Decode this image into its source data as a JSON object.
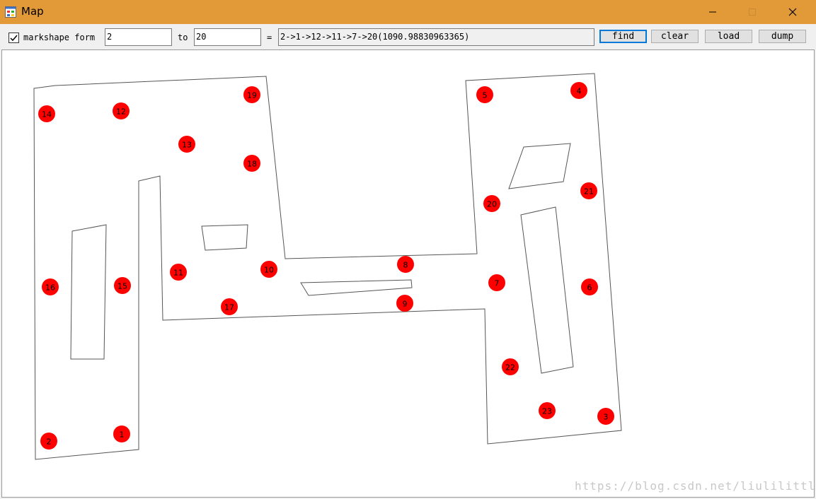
{
  "window": {
    "title": "Map",
    "icons": {
      "app": "app-window-icon",
      "minimize": "minimize-icon",
      "maximize": "maximize-icon",
      "close": "close-icon"
    }
  },
  "toolbar": {
    "markshape_checked": true,
    "markshape_label": "markshape form",
    "from_value": "2",
    "to_label": "to",
    "to_value": "20",
    "equals_label": "=",
    "result_value": "2->1->12->11->7->20(1090.98830963365)",
    "find_label": "find",
    "clear_label": "clear",
    "load_label": "load",
    "dump_label": "dump"
  },
  "map": {
    "nodes": [
      {
        "id": "1",
        "label": "1"
      },
      {
        "id": "2",
        "label": "2"
      },
      {
        "id": "3",
        "label": "3"
      },
      {
        "id": "4",
        "label": "4"
      },
      {
        "id": "5",
        "label": "5"
      },
      {
        "id": "6",
        "label": "6"
      },
      {
        "id": "7",
        "label": "7"
      },
      {
        "id": "8",
        "label": "8"
      },
      {
        "id": "9",
        "label": "9"
      },
      {
        "id": "10",
        "label": "10"
      },
      {
        "id": "11",
        "label": "11"
      },
      {
        "id": "12",
        "label": "12"
      },
      {
        "id": "13",
        "label": "13"
      },
      {
        "id": "14",
        "label": "14"
      },
      {
        "id": "15",
        "label": "15"
      },
      {
        "id": "16",
        "label": "16"
      },
      {
        "id": "17",
        "label": "17"
      },
      {
        "id": "18",
        "label": "18"
      },
      {
        "id": "19",
        "label": "19"
      },
      {
        "id": "20",
        "label": "20"
      },
      {
        "id": "21",
        "label": "21"
      },
      {
        "id": "22",
        "label": "22"
      },
      {
        "id": "23",
        "label": "23"
      }
    ],
    "node_color": "#ff0000"
  },
  "watermark": "https://blog.csdn.net/liulilittle"
}
